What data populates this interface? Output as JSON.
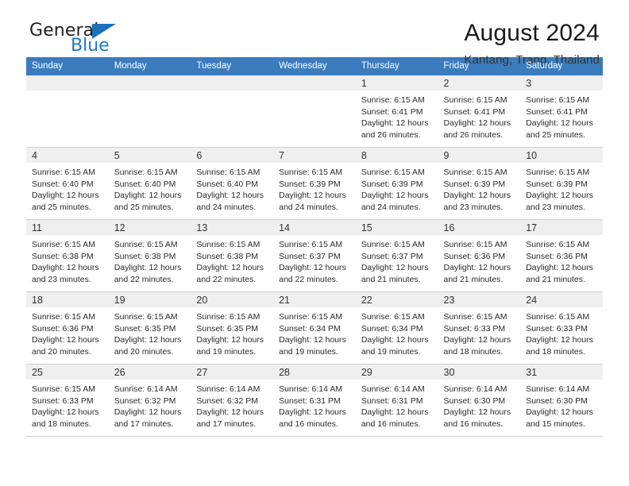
{
  "brand": {
    "name_top": "General",
    "name_bottom": "Blue",
    "accent_color": "#1e7ac4",
    "triangle_color": "#1e70b8"
  },
  "header": {
    "month_title": "August 2024",
    "location": "Kantang, Trang, Thailand"
  },
  "theme": {
    "header_row_bg": "#3a7cbe",
    "header_row_text": "#ffffff",
    "daynum_bg": "#efefef",
    "cell_border": "#d0d0d0"
  },
  "weekdays": [
    "Sunday",
    "Monday",
    "Tuesday",
    "Wednesday",
    "Thursday",
    "Friday",
    "Saturday"
  ],
  "labels": {
    "sunrise_prefix": "Sunrise:",
    "sunset_prefix": "Sunset:",
    "daylight_prefix": "Daylight:"
  },
  "weeks": [
    [
      {
        "empty": true
      },
      {
        "empty": true
      },
      {
        "empty": true
      },
      {
        "empty": true
      },
      {
        "day": "1",
        "sunrise": "Sunrise: 6:15 AM",
        "sunset": "Sunset: 6:41 PM",
        "daylight_1": "Daylight: 12 hours",
        "daylight_2": "and 26 minutes."
      },
      {
        "day": "2",
        "sunrise": "Sunrise: 6:15 AM",
        "sunset": "Sunset: 6:41 PM",
        "daylight_1": "Daylight: 12 hours",
        "daylight_2": "and 26 minutes."
      },
      {
        "day": "3",
        "sunrise": "Sunrise: 6:15 AM",
        "sunset": "Sunset: 6:41 PM",
        "daylight_1": "Daylight: 12 hours",
        "daylight_2": "and 25 minutes."
      }
    ],
    [
      {
        "day": "4",
        "sunrise": "Sunrise: 6:15 AM",
        "sunset": "Sunset: 6:40 PM",
        "daylight_1": "Daylight: 12 hours",
        "daylight_2": "and 25 minutes."
      },
      {
        "day": "5",
        "sunrise": "Sunrise: 6:15 AM",
        "sunset": "Sunset: 6:40 PM",
        "daylight_1": "Daylight: 12 hours",
        "daylight_2": "and 25 minutes."
      },
      {
        "day": "6",
        "sunrise": "Sunrise: 6:15 AM",
        "sunset": "Sunset: 6:40 PM",
        "daylight_1": "Daylight: 12 hours",
        "daylight_2": "and 24 minutes."
      },
      {
        "day": "7",
        "sunrise": "Sunrise: 6:15 AM",
        "sunset": "Sunset: 6:39 PM",
        "daylight_1": "Daylight: 12 hours",
        "daylight_2": "and 24 minutes."
      },
      {
        "day": "8",
        "sunrise": "Sunrise: 6:15 AM",
        "sunset": "Sunset: 6:39 PM",
        "daylight_1": "Daylight: 12 hours",
        "daylight_2": "and 24 minutes."
      },
      {
        "day": "9",
        "sunrise": "Sunrise: 6:15 AM",
        "sunset": "Sunset: 6:39 PM",
        "daylight_1": "Daylight: 12 hours",
        "daylight_2": "and 23 minutes."
      },
      {
        "day": "10",
        "sunrise": "Sunrise: 6:15 AM",
        "sunset": "Sunset: 6:39 PM",
        "daylight_1": "Daylight: 12 hours",
        "daylight_2": "and 23 minutes."
      }
    ],
    [
      {
        "day": "11",
        "sunrise": "Sunrise: 6:15 AM",
        "sunset": "Sunset: 6:38 PM",
        "daylight_1": "Daylight: 12 hours",
        "daylight_2": "and 23 minutes."
      },
      {
        "day": "12",
        "sunrise": "Sunrise: 6:15 AM",
        "sunset": "Sunset: 6:38 PM",
        "daylight_1": "Daylight: 12 hours",
        "daylight_2": "and 22 minutes."
      },
      {
        "day": "13",
        "sunrise": "Sunrise: 6:15 AM",
        "sunset": "Sunset: 6:38 PM",
        "daylight_1": "Daylight: 12 hours",
        "daylight_2": "and 22 minutes."
      },
      {
        "day": "14",
        "sunrise": "Sunrise: 6:15 AM",
        "sunset": "Sunset: 6:37 PM",
        "daylight_1": "Daylight: 12 hours",
        "daylight_2": "and 22 minutes."
      },
      {
        "day": "15",
        "sunrise": "Sunrise: 6:15 AM",
        "sunset": "Sunset: 6:37 PM",
        "daylight_1": "Daylight: 12 hours",
        "daylight_2": "and 21 minutes."
      },
      {
        "day": "16",
        "sunrise": "Sunrise: 6:15 AM",
        "sunset": "Sunset: 6:36 PM",
        "daylight_1": "Daylight: 12 hours",
        "daylight_2": "and 21 minutes."
      },
      {
        "day": "17",
        "sunrise": "Sunrise: 6:15 AM",
        "sunset": "Sunset: 6:36 PM",
        "daylight_1": "Daylight: 12 hours",
        "daylight_2": "and 21 minutes."
      }
    ],
    [
      {
        "day": "18",
        "sunrise": "Sunrise: 6:15 AM",
        "sunset": "Sunset: 6:36 PM",
        "daylight_1": "Daylight: 12 hours",
        "daylight_2": "and 20 minutes."
      },
      {
        "day": "19",
        "sunrise": "Sunrise: 6:15 AM",
        "sunset": "Sunset: 6:35 PM",
        "daylight_1": "Daylight: 12 hours",
        "daylight_2": "and 20 minutes."
      },
      {
        "day": "20",
        "sunrise": "Sunrise: 6:15 AM",
        "sunset": "Sunset: 6:35 PM",
        "daylight_1": "Daylight: 12 hours",
        "daylight_2": "and 19 minutes."
      },
      {
        "day": "21",
        "sunrise": "Sunrise: 6:15 AM",
        "sunset": "Sunset: 6:34 PM",
        "daylight_1": "Daylight: 12 hours",
        "daylight_2": "and 19 minutes."
      },
      {
        "day": "22",
        "sunrise": "Sunrise: 6:15 AM",
        "sunset": "Sunset: 6:34 PM",
        "daylight_1": "Daylight: 12 hours",
        "daylight_2": "and 19 minutes."
      },
      {
        "day": "23",
        "sunrise": "Sunrise: 6:15 AM",
        "sunset": "Sunset: 6:33 PM",
        "daylight_1": "Daylight: 12 hours",
        "daylight_2": "and 18 minutes."
      },
      {
        "day": "24",
        "sunrise": "Sunrise: 6:15 AM",
        "sunset": "Sunset: 6:33 PM",
        "daylight_1": "Daylight: 12 hours",
        "daylight_2": "and 18 minutes."
      }
    ],
    [
      {
        "day": "25",
        "sunrise": "Sunrise: 6:15 AM",
        "sunset": "Sunset: 6:33 PM",
        "daylight_1": "Daylight: 12 hours",
        "daylight_2": "and 18 minutes."
      },
      {
        "day": "26",
        "sunrise": "Sunrise: 6:14 AM",
        "sunset": "Sunset: 6:32 PM",
        "daylight_1": "Daylight: 12 hours",
        "daylight_2": "and 17 minutes."
      },
      {
        "day": "27",
        "sunrise": "Sunrise: 6:14 AM",
        "sunset": "Sunset: 6:32 PM",
        "daylight_1": "Daylight: 12 hours",
        "daylight_2": "and 17 minutes."
      },
      {
        "day": "28",
        "sunrise": "Sunrise: 6:14 AM",
        "sunset": "Sunset: 6:31 PM",
        "daylight_1": "Daylight: 12 hours",
        "daylight_2": "and 16 minutes."
      },
      {
        "day": "29",
        "sunrise": "Sunrise: 6:14 AM",
        "sunset": "Sunset: 6:31 PM",
        "daylight_1": "Daylight: 12 hours",
        "daylight_2": "and 16 minutes."
      },
      {
        "day": "30",
        "sunrise": "Sunrise: 6:14 AM",
        "sunset": "Sunset: 6:30 PM",
        "daylight_1": "Daylight: 12 hours",
        "daylight_2": "and 16 minutes."
      },
      {
        "day": "31",
        "sunrise": "Sunrise: 6:14 AM",
        "sunset": "Sunset: 6:30 PM",
        "daylight_1": "Daylight: 12 hours",
        "daylight_2": "and 15 minutes."
      }
    ]
  ]
}
